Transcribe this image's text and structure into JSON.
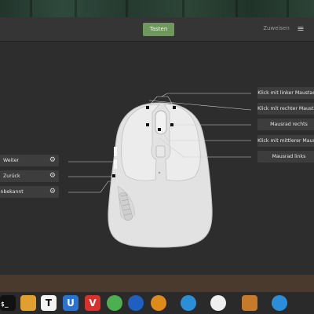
{
  "header": {
    "tab_label": "Tasten",
    "assign_label": "Zuweisen",
    "menu_icon": "menu-icon"
  },
  "right_buttons": [
    {
      "label": "Klick mit linker Maustaste"
    },
    {
      "label": "Klick mit rechter Maustaste"
    },
    {
      "label": "Mausrad rechts"
    },
    {
      "label": "Klick mit mittlerer Maustaste"
    },
    {
      "label": "Mausrad links"
    }
  ],
  "left_buttons": [
    {
      "label": "Weiter"
    },
    {
      "label": "Zurück"
    },
    {
      "label": "Unbekannt"
    }
  ],
  "dock": {
    "terminal_text": "$_",
    "apps": [
      {
        "name": "terminal-icon",
        "glyph": "",
        "color": "#111111"
      },
      {
        "name": "files-icon",
        "glyph": "",
        "color": "#e0a030"
      },
      {
        "name": "typora-icon",
        "glyph": "T",
        "color": "#f4f4f4"
      },
      {
        "name": "uget-icon",
        "glyph": "U",
        "color": "#2a73d0"
      },
      {
        "name": "vivaldi-icon",
        "glyph": "V",
        "color": "#d8322e"
      },
      {
        "name": "green-app-icon",
        "glyph": "",
        "color": "#4caf50"
      },
      {
        "name": "blue-globe-icon",
        "glyph": "",
        "color": "#1e5fbf"
      },
      {
        "name": "sun-app-icon",
        "glyph": "",
        "color": "#e08a1a"
      },
      {
        "name": "sync-icon",
        "glyph": "",
        "color": "#2a8fd8"
      },
      {
        "name": "disc-icon",
        "glyph": "",
        "color": "#efefef"
      },
      {
        "name": "archive-icon",
        "glyph": "",
        "color": "#c77a2a"
      },
      {
        "name": "sync-alt-icon",
        "glyph": "",
        "color": "#2a8fd8"
      }
    ]
  },
  "colors": {
    "accent": "#6d9a5a",
    "window_bg": "#2d2d2d",
    "button_bg": "#3d3d3d",
    "mouse_body": "#e2e2e2"
  }
}
